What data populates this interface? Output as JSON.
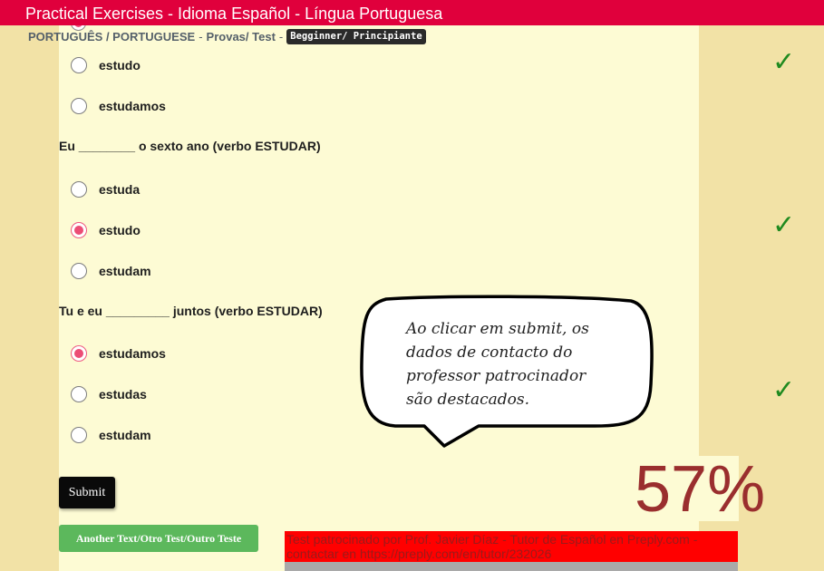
{
  "header": {
    "title": "Practical Exercises - Idioma Español - Língua Portuguesa"
  },
  "breadcrumb": {
    "course": "PORTUGUÊS / PORTUGUESE",
    "separator": "-",
    "section": "Provas/ Test",
    "level": "Begginner/ Principiante"
  },
  "questions": [
    {
      "options": [
        {
          "label": "estudo",
          "checked": false
        },
        {
          "label": "estudamos",
          "checked": false
        }
      ],
      "correct": true
    },
    {
      "prompt": "Eu ________ o sexto ano (verbo ESTUDAR)",
      "options": [
        {
          "label": "estuda",
          "checked": false
        },
        {
          "label": "estudo",
          "checked": true
        },
        {
          "label": "estudam",
          "checked": false
        }
      ],
      "correct": true
    },
    {
      "prompt": "Tu e eu _________ juntos (verbo ESTUDAR)",
      "options": [
        {
          "label": "estudamos",
          "checked": true
        },
        {
          "label": "estudas",
          "checked": false
        },
        {
          "label": "estudam",
          "checked": false
        }
      ],
      "correct": true
    }
  ],
  "check_icon": "checkmark-icon",
  "callout": {
    "text": "Ao clicar em submit, os dados de contacto do professor patrocinador são destacados."
  },
  "buttons": {
    "submit": "Submit",
    "another_test": "Another Text/Otro Test/Outro Teste"
  },
  "score": "57%",
  "sponsor": "Test patrocinado por Prof. Javier Díaz - Tutor de Español en Preply.com - contactar en https://preply.com/en/tutor/232026",
  "colors": {
    "header": "#e0003c",
    "panel": "#fdfbd4",
    "background": "#f2e2a6",
    "check": "#1f8a1f",
    "score": "#9a2e2e",
    "sponsor": "#ff0000",
    "submit": "#0a0a0a",
    "another": "#5cb85c"
  }
}
